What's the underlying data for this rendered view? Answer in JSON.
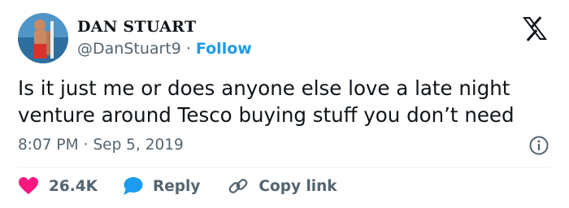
{
  "author": {
    "name": "DAN STUART",
    "handle": "@DanStuart9",
    "separator": "·",
    "follow_label": "Follow",
    "avatar_icon": "avatar-photo"
  },
  "platform_logo": "x-logo",
  "tweet": {
    "text_line1": "Is it just me or does anyone else love a late night",
    "text_line2": "venture around Tesco buying stuff you don’t need"
  },
  "meta": {
    "time": "8:07 PM",
    "separator": "·",
    "date": "Sep 5, 2019",
    "info_icon": "info-icon"
  },
  "actions": {
    "likes_count": "26.4K",
    "reply_label": "Reply",
    "copy_link_label": "Copy link"
  },
  "colors": {
    "accent": "#1d9bf0",
    "like": "#f91880",
    "text": "#0f1419",
    "muted": "#536471"
  }
}
